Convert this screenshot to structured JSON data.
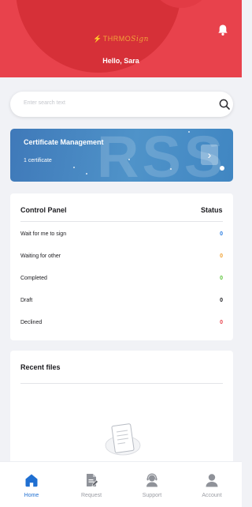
{
  "header": {
    "logo_text": "THRMO",
    "logo_script": "Sign",
    "greeting": "Hello, Sara",
    "icons": {
      "notification": "bell-icon"
    }
  },
  "search": {
    "placeholder": "Enter search text",
    "icon": "search-icon"
  },
  "certificate": {
    "title": "Certificate Management",
    "count_label": "1 certificate",
    "background_text": "RSS",
    "arrow_icon": "chevron-right-icon"
  },
  "control_panel": {
    "title": "Control Panel",
    "status_header": "Status",
    "rows": [
      {
        "label": "Wait for me to sign",
        "value": "0",
        "color": "#2a7de1"
      },
      {
        "label": "Waiting for other",
        "value": "0",
        "color": "#f0a030"
      },
      {
        "label": "Completed",
        "value": "0",
        "color": "#5cc43a"
      },
      {
        "label": "Draft",
        "value": "0",
        "color": "#1b1b1f"
      },
      {
        "label": "Declined",
        "value": "0",
        "color": "#e8424c"
      }
    ]
  },
  "recent_files": {
    "title": "Recent files",
    "empty_icon": "empty-document-icon"
  },
  "tabbar": {
    "tabs": [
      {
        "label": "Home",
        "icon": "home-icon",
        "active": true
      },
      {
        "label": "Request",
        "icon": "document-edit-icon",
        "active": false
      },
      {
        "label": "Support",
        "icon": "support-agent-icon",
        "active": false
      },
      {
        "label": "Account",
        "icon": "user-icon",
        "active": false
      }
    ]
  },
  "colors": {
    "brand_red": "#e8424c",
    "accent_blue": "#1f6fd1",
    "card_blue": "#4f93c9"
  }
}
